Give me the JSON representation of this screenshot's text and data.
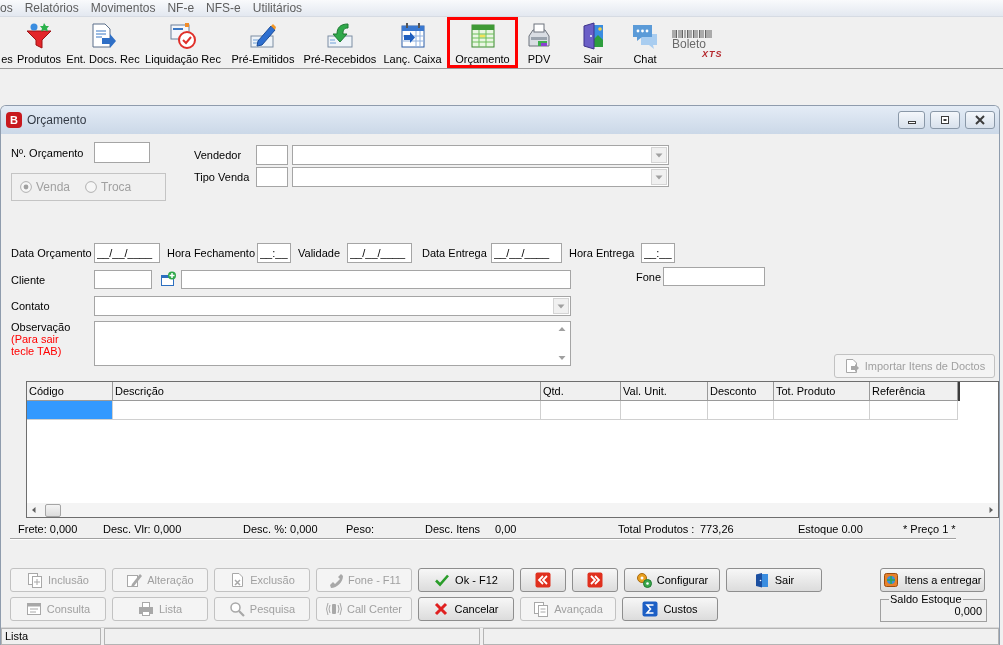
{
  "menu": [
    "os",
    "Relatórios",
    "Movimentos",
    "NF-e",
    "NFS-e",
    "Utilitários"
  ],
  "toolbar": [
    {
      "label": "es",
      "selected": false
    },
    {
      "label": "Produtos",
      "selected": false
    },
    {
      "label": "Ent. Docs. Rec",
      "selected": false
    },
    {
      "label": "Liquidação Rec",
      "selected": false
    },
    {
      "label": "Pré-Emitidos",
      "selected": false
    },
    {
      "label": "Pré-Recebidos",
      "selected": false
    },
    {
      "label": "Lanç. Caixa",
      "selected": false
    },
    {
      "label": "Orçamento",
      "selected": true
    },
    {
      "label": "PDV",
      "selected": false
    },
    {
      "label": "Sair",
      "selected": false
    },
    {
      "label": "Chat",
      "selected": false
    }
  ],
  "logo": {
    "text": "Boleto",
    "mark": "XTS"
  },
  "window": {
    "icon_letter": "B",
    "title": "Orçamento"
  },
  "form": {
    "numero": {
      "label": "Nº. Orçamento"
    },
    "sale_type": {
      "disabled": true,
      "options": [
        {
          "label": "Venda",
          "selected": true
        },
        {
          "label": "Troca",
          "selected": false
        }
      ]
    },
    "vendedor": {
      "label": "Vendedor"
    },
    "tipo_venda": {
      "label": "Tipo Venda"
    },
    "dates": [
      {
        "label": "Data Orçamento",
        "value": "__/__/____"
      },
      {
        "label": "Hora Fechamento",
        "value": "__:__"
      },
      {
        "label": "Validade",
        "value": "__/__/____"
      },
      {
        "label": "Data Entrega",
        "value": "__/__/____"
      },
      {
        "label": "Hora Entrega",
        "value": "__:__"
      }
    ],
    "cliente": {
      "label": "Cliente"
    },
    "fone": {
      "label": "Fone"
    },
    "contato": {
      "label": "Contato"
    },
    "observacao": {
      "label": "Observação",
      "hint": "(Para sair tecle TAB)"
    },
    "import_button": {
      "label": "Importar Itens de Doctos",
      "disabled": true
    }
  },
  "table": {
    "columns": [
      "Código",
      "Descrição",
      "Qtd.",
      "Val. Unit.",
      "Desconto",
      "Tot. Produto",
      "Referência"
    ],
    "rows": [
      {
        "selected": true
      }
    ]
  },
  "totals": [
    "Frete: 0,000",
    "Desc. Vlr: 0,000",
    "Desc. %: 0,000",
    "Peso:",
    "Desc. Itens",
    "0,00",
    "Total Produtos :",
    "773,26",
    "Estoque 0.00",
    "* Preço 1 *"
  ],
  "buttons": [
    [
      {
        "kind": "text",
        "label": "Inclusão",
        "disabled": true
      },
      {
        "kind": "text",
        "label": "Alteração",
        "disabled": true
      },
      {
        "kind": "text",
        "label": "Exclusão",
        "disabled": true
      },
      {
        "kind": "text",
        "label": "Fone - F11",
        "disabled": true
      },
      {
        "kind": "text",
        "label": "Ok - F12",
        "disabled": false
      },
      {
        "kind": "icon",
        "disabled": false
      },
      {
        "kind": "icon",
        "disabled": false
      },
      {
        "kind": "text",
        "label": "Configurar",
        "disabled": false
      },
      {
        "kind": "text",
        "label": "Sair",
        "disabled": false
      }
    ],
    [
      {
        "kind": "text",
        "label": "Consulta",
        "disabled": true
      },
      {
        "kind": "text",
        "label": "Lista",
        "disabled": true
      },
      {
        "kind": "text",
        "label": "Pesquisa",
        "disabled": true
      },
      {
        "kind": "text",
        "label": "Call Center",
        "disabled": true
      },
      {
        "kind": "text",
        "label": "Cancelar",
        "disabled": false
      },
      {
        "kind": "text",
        "label": "Avançada",
        "disabled": true
      },
      {
        "kind": "text",
        "label": "Custos",
        "disabled": false
      }
    ]
  ],
  "side": {
    "button": {
      "label": "Itens a entregar",
      "disabled": false
    },
    "stock": {
      "label": "Saldo Estoque",
      "value": "0,000"
    }
  },
  "status_bar": [
    "Lista"
  ]
}
